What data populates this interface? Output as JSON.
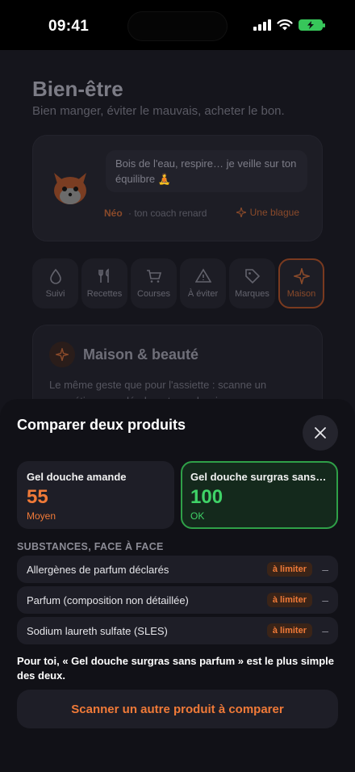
{
  "status_bar": {
    "time": "09:41"
  },
  "page": {
    "title": "Bien-être",
    "subtitle": "Bien manger, éviter le mauvais, acheter le bon.",
    "coach": {
      "message": "Bois de l'eau, respire… je veille sur ton équilibre 🧘",
      "name": "Néo",
      "role": "· ton coach renard",
      "joke_label": "Une blague"
    },
    "tabs": [
      {
        "label": "Suivi",
        "icon": "drop-icon"
      },
      {
        "label": "Recettes",
        "icon": "utensils-icon"
      },
      {
        "label": "Courses",
        "icon": "cart-icon"
      },
      {
        "label": "À éviter",
        "icon": "warning-icon"
      },
      {
        "label": "Marques",
        "icon": "tag-icon"
      },
      {
        "label": "Maison",
        "icon": "sparkle-icon",
        "active": true
      }
    ],
    "home_card": {
      "title": "Maison & beauté",
      "text": "Le même geste que pour l'assiette : scanne un cosmétique, un déodorant, une lessive ou un nettoyant…"
    }
  },
  "sheet": {
    "title": "Comparer deux produits",
    "products": [
      {
        "name": "Gel douche amande",
        "score": "55",
        "grade": "Moyen",
        "color": "#f07a38"
      },
      {
        "name": "Gel douche surgras sans parfum",
        "score": "100",
        "grade": "OK",
        "color": "#3fd267"
      }
    ],
    "section_label": "SUBSTANCES, FACE À FACE",
    "substances": [
      {
        "name": "Allergènes de parfum déclarés",
        "badge": "à limiter",
        "other": "–"
      },
      {
        "name": "Parfum (composition non détaillée)",
        "badge": "à limiter",
        "other": "–"
      },
      {
        "name": "Sodium laureth sulfate (SLES)",
        "badge": "à limiter",
        "other": "–"
      }
    ],
    "verdict": "Pour toi, « Gel douche surgras sans parfum » est le plus simple des deux.",
    "scan_button": "Scanner un autre produit à comparer"
  },
  "colors": {
    "accent": "#f07a38",
    "ok": "#3fd267",
    "sheet_bg": "#111117"
  }
}
